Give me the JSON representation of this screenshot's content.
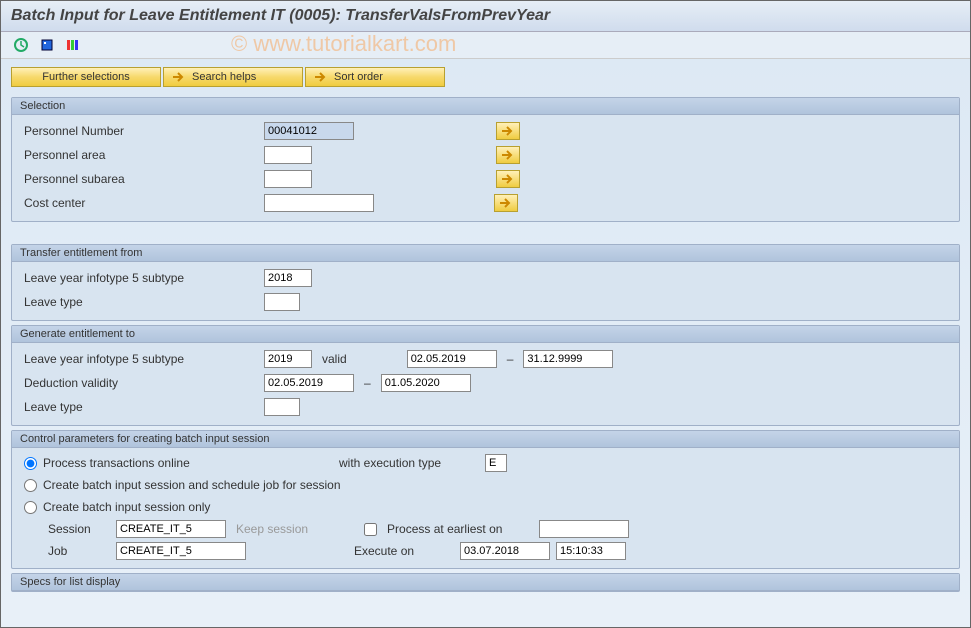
{
  "title": "Batch Input for Leave Entitlement IT (0005): TransferValsFromPrevYear",
  "watermark": "© www.tutorialkart.com",
  "buttons": {
    "further_selections": "Further selections",
    "search_helps": "Search helps",
    "sort_order": "Sort order"
  },
  "selection": {
    "title": "Selection",
    "personnel_number_label": "Personnel Number",
    "personnel_number_value": "00041012",
    "personnel_area_label": "Personnel area",
    "personnel_area_value": "",
    "personnel_subarea_label": "Personnel subarea",
    "personnel_subarea_value": "",
    "cost_center_label": "Cost center",
    "cost_center_value": ""
  },
  "transfer_from": {
    "title": "Transfer entitlement from",
    "leave_year_label": "Leave year infotype 5 subtype",
    "leave_year_value": "2018",
    "leave_type_label": "Leave type",
    "leave_type_value": ""
  },
  "generate_to": {
    "title": "Generate entitlement to",
    "leave_year_label": "Leave year infotype 5 subtype",
    "leave_year_value": "2019",
    "valid_label": "valid",
    "valid_from": "02.05.2019",
    "valid_to": "31.12.9999",
    "deduction_label": "Deduction validity",
    "deduction_from": "02.05.2019",
    "deduction_to": "01.05.2020",
    "leave_type_label": "Leave type",
    "leave_type_value": "",
    "dash": "–"
  },
  "control": {
    "title": "Control parameters for creating batch input session",
    "opt_online": "Process transactions online",
    "with_exec_label": "with execution type",
    "exec_type_value": "E",
    "opt_schedule": "Create batch input session and schedule job for session",
    "opt_only": "Create batch input session only",
    "session_label": "Session",
    "session_value": "CREATE_IT_5",
    "keep_session_label": "Keep session",
    "process_earliest_label": "Process at earliest on",
    "process_earliest_value": "",
    "job_label": "Job",
    "job_value": "CREATE_IT_5",
    "execute_on_label": "Execute on",
    "execute_on_date": "03.07.2018",
    "execute_on_time": "15:10:33"
  },
  "specs": {
    "title": "Specs for list display"
  }
}
